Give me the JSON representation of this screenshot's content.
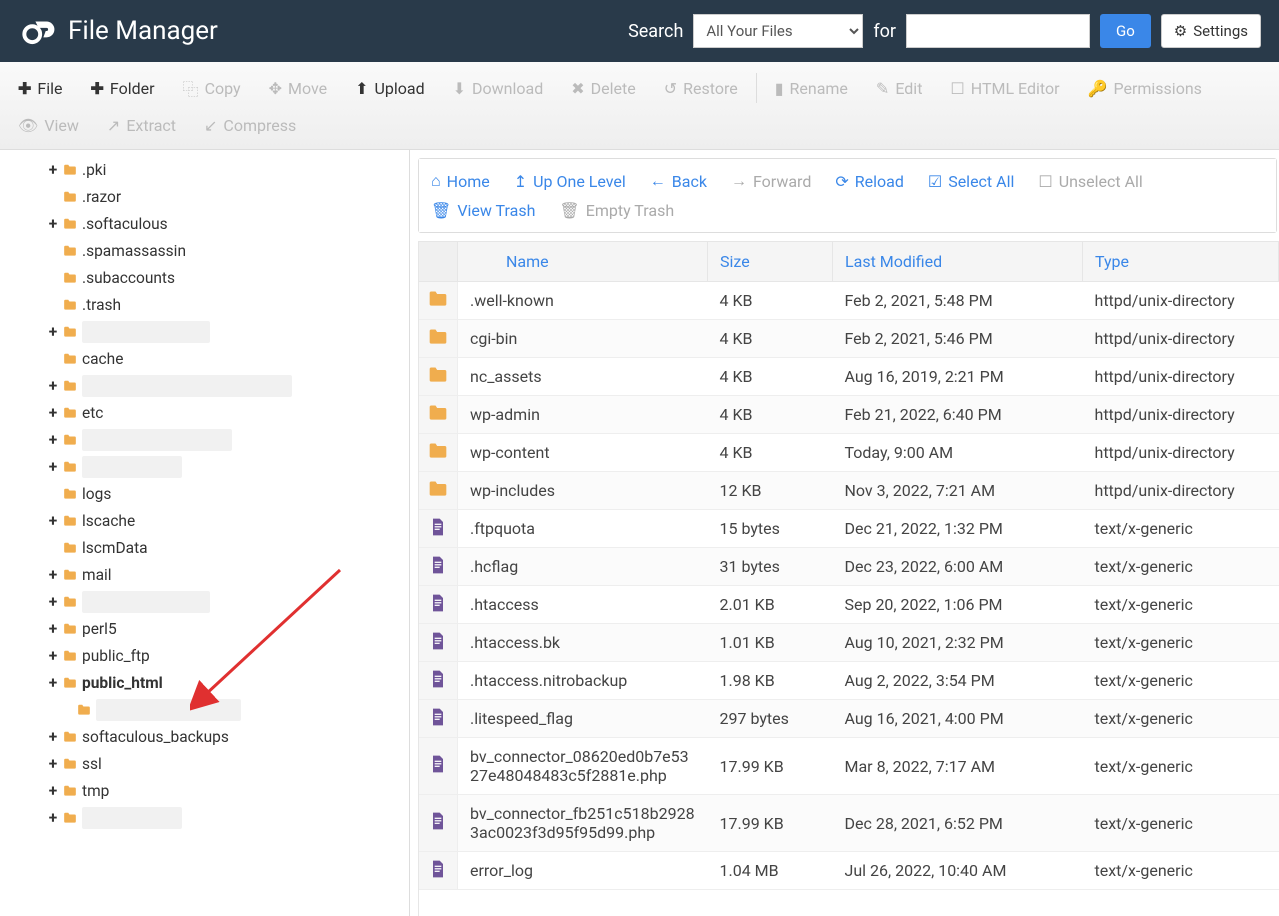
{
  "header": {
    "title": "File Manager",
    "search_label": "Search",
    "for_label": "for",
    "select_value": "All Your Files",
    "go_label": "Go",
    "settings_label": "Settings"
  },
  "toolbar": {
    "file": "File",
    "folder": "Folder",
    "copy": "Copy",
    "move": "Move",
    "upload": "Upload",
    "download": "Download",
    "delete": "Delete",
    "restore": "Restore",
    "rename": "Rename",
    "edit": "Edit",
    "html_editor": "HTML Editor",
    "permissions": "Permissions",
    "view": "View",
    "extract": "Extract",
    "compress": "Compress"
  },
  "tree": [
    {
      "name": ".pki",
      "expander": "+",
      "indent": 1,
      "redacted": false
    },
    {
      "name": ".razor",
      "expander": "",
      "indent": 1,
      "redacted": false
    },
    {
      "name": ".softaculous",
      "expander": "+",
      "indent": 1,
      "redacted": false
    },
    {
      "name": ".spamassassin",
      "expander": "",
      "indent": 1,
      "redacted": false
    },
    {
      "name": ".subaccounts",
      "expander": "",
      "indent": 1,
      "redacted": false
    },
    {
      "name": ".trash",
      "expander": "",
      "indent": 1,
      "redacted": false
    },
    {
      "name": "",
      "expander": "+",
      "indent": 1,
      "redacted": true,
      "rw": 128
    },
    {
      "name": "cache",
      "expander": "",
      "indent": 1,
      "redacted": false
    },
    {
      "name": "",
      "expander": "+",
      "indent": 1,
      "redacted": true,
      "rw": 210
    },
    {
      "name": "etc",
      "expander": "+",
      "indent": 1,
      "redacted": false
    },
    {
      "name": "",
      "expander": "+",
      "indent": 1,
      "redacted": true,
      "rw": 150
    },
    {
      "name": "",
      "expander": "+",
      "indent": 1,
      "redacted": true,
      "rw": 100
    },
    {
      "name": "logs",
      "expander": "",
      "indent": 1,
      "redacted": false
    },
    {
      "name": "lscache",
      "expander": "+",
      "indent": 1,
      "redacted": false
    },
    {
      "name": "lscmData",
      "expander": "",
      "indent": 1,
      "redacted": false
    },
    {
      "name": "mail",
      "expander": "+",
      "indent": 1,
      "redacted": false
    },
    {
      "name": "",
      "expander": "+",
      "indent": 1,
      "redacted": true,
      "rw": 128
    },
    {
      "name": "perl5",
      "expander": "+",
      "indent": 1,
      "redacted": false
    },
    {
      "name": "public_ftp",
      "expander": "+",
      "indent": 1,
      "redacted": false
    },
    {
      "name": "public_html",
      "expander": "+",
      "indent": 1,
      "redacted": false,
      "bold": true
    },
    {
      "name": "",
      "expander": "",
      "indent": 2,
      "redacted": true,
      "rw": 145
    },
    {
      "name": "softaculous_backups",
      "expander": "+",
      "indent": 1,
      "redacted": false
    },
    {
      "name": "ssl",
      "expander": "+",
      "indent": 1,
      "redacted": false
    },
    {
      "name": "tmp",
      "expander": "+",
      "indent": 1,
      "redacted": false
    },
    {
      "name": "",
      "expander": "+",
      "indent": 1,
      "redacted": true,
      "rw": 100
    }
  ],
  "content_toolbar": {
    "home": "Home",
    "up": "Up One Level",
    "back": "Back",
    "forward": "Forward",
    "reload": "Reload",
    "select_all": "Select All",
    "unselect_all": "Unselect All",
    "view_trash": "View Trash",
    "empty_trash": "Empty Trash"
  },
  "columns": {
    "name": "Name",
    "size": "Size",
    "modified": "Last Modified",
    "type": "Type"
  },
  "files": [
    {
      "icon": "folder",
      "name": ".well-known",
      "size": "4 KB",
      "modified": "Feb 2, 2021, 5:48 PM",
      "type": "httpd/unix-directory"
    },
    {
      "icon": "folder",
      "name": "cgi-bin",
      "size": "4 KB",
      "modified": "Feb 2, 2021, 5:46 PM",
      "type": "httpd/unix-directory"
    },
    {
      "icon": "folder",
      "name": "nc_assets",
      "size": "4 KB",
      "modified": "Aug 16, 2019, 2:21 PM",
      "type": "httpd/unix-directory"
    },
    {
      "icon": "folder",
      "name": "wp-admin",
      "size": "4 KB",
      "modified": "Feb 21, 2022, 6:40 PM",
      "type": "httpd/unix-directory"
    },
    {
      "icon": "folder",
      "name": "wp-content",
      "size": "4 KB",
      "modified": "Today, 9:00 AM",
      "type": "httpd/unix-directory"
    },
    {
      "icon": "folder",
      "name": "wp-includes",
      "size": "12 KB",
      "modified": "Nov 3, 2022, 7:21 AM",
      "type": "httpd/unix-directory"
    },
    {
      "icon": "file",
      "name": ".ftpquota",
      "size": "15 bytes",
      "modified": "Dec 21, 2022, 1:32 PM",
      "type": "text/x-generic"
    },
    {
      "icon": "file",
      "name": ".hcflag",
      "size": "31 bytes",
      "modified": "Dec 23, 2022, 6:00 AM",
      "type": "text/x-generic"
    },
    {
      "icon": "file",
      "name": ".htaccess",
      "size": "2.01 KB",
      "modified": "Sep 20, 2022, 1:06 PM",
      "type": "text/x-generic"
    },
    {
      "icon": "file",
      "name": ".htaccess.bk",
      "size": "1.01 KB",
      "modified": "Aug 10, 2021, 2:32 PM",
      "type": "text/x-generic"
    },
    {
      "icon": "file",
      "name": ".htaccess.nitrobackup",
      "size": "1.98 KB",
      "modified": "Aug 2, 2022, 3:54 PM",
      "type": "text/x-generic"
    },
    {
      "icon": "file",
      "name": ".litespeed_flag",
      "size": "297 bytes",
      "modified": "Aug 16, 2021, 4:00 PM",
      "type": "text/x-generic"
    },
    {
      "icon": "file",
      "name": "bv_connector_08620ed0b7e5327e48048483c5f2881e.php",
      "size": "17.99 KB",
      "modified": "Mar 8, 2022, 7:17 AM",
      "type": "text/x-generic"
    },
    {
      "icon": "file",
      "name": "bv_connector_fb251c518b29283ac0023f3d95f95d99.php",
      "size": "17.99 KB",
      "modified": "Dec 28, 2021, 6:52 PM",
      "type": "text/x-generic"
    },
    {
      "icon": "file",
      "name": "error_log",
      "size": "1.04 MB",
      "modified": "Jul 26, 2022, 10:40 AM",
      "type": "text/x-generic"
    }
  ]
}
